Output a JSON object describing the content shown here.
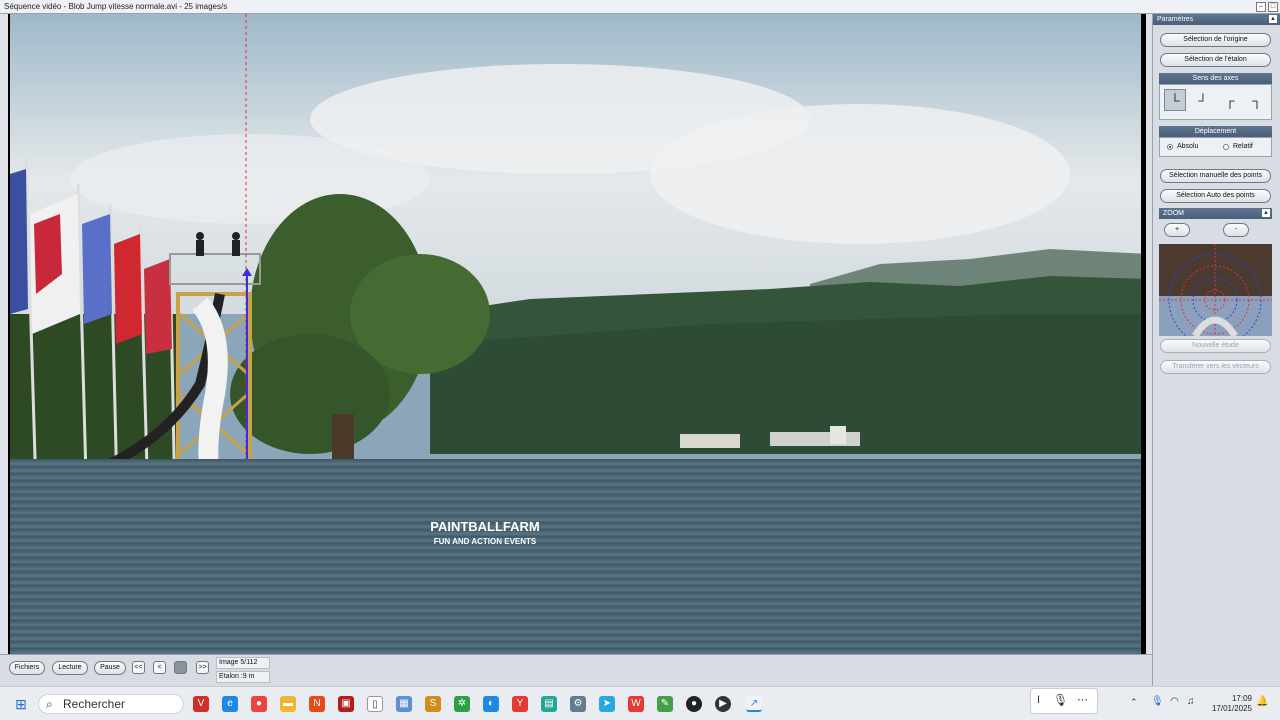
{
  "window": {
    "title": "Séquence vidéo - Blob Jump vitesse normale.avi - 25 images/s"
  },
  "controls": {
    "fichiers": "Fichiers",
    "lecture": "Lecture",
    "pause": "Pause",
    "first": "<<",
    "prev": "<",
    "next": ">>",
    "image_label": "Image 5/112",
    "etalon_label": "Etalon :9 m"
  },
  "panel": {
    "header": "Paramètres",
    "origine_button": "Sélection de l'origine",
    "etalon_button": "Sélection de l'étalon",
    "sens_axes_header": "Sens des axes",
    "deplacement_header": "Déplacement",
    "absolu_label": "Absolu",
    "relatif_label": "Relatif",
    "manual_points_button": "Sélection manuelle des points",
    "auto_points_button": "Sélection Auto des points",
    "zoom_header": "ZOOM",
    "zoom_plus": "+",
    "zoom_minus": "-",
    "new_study_button": "Nouvelle étude",
    "transfer_button": "Transférer vers les vecteurs"
  },
  "video": {
    "banner_text": "PAINTBALLFARM",
    "banner_sub": "FUN AND ACTION EVENTS",
    "accent_origin_color": "#e0303a",
    "accent_axis_color": "#3a2fe0"
  },
  "taskbar": {
    "search_placeholder": "Rechercher",
    "time": "17:09",
    "date": "17/01/2025"
  }
}
